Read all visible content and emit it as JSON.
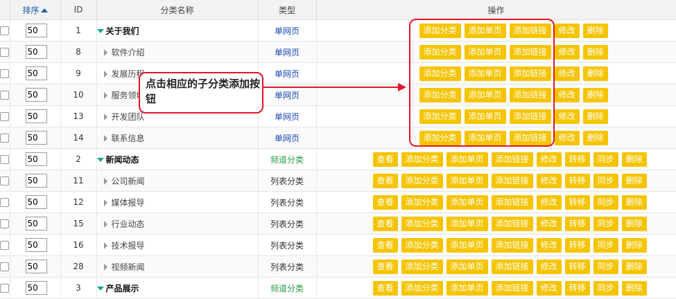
{
  "headers": {
    "sort": "排序",
    "id": "ID",
    "name": "分类名称",
    "type": "类型",
    "ops": "操作"
  },
  "rows": [
    {
      "sort": "50",
      "id": "1",
      "name": "关于我们",
      "level": 0,
      "type": "单网页",
      "type_class": "t-page",
      "ops": [
        "添加分类",
        "添加单页",
        "添加链接",
        "修改",
        "删除"
      ]
    },
    {
      "sort": "50",
      "id": "8",
      "name": "软件介绍",
      "level": 1,
      "type": "单网页",
      "type_class": "t-page",
      "ops": [
        "添加分类",
        "添加单页",
        "添加链接",
        "修改",
        "删除"
      ]
    },
    {
      "sort": "50",
      "id": "9",
      "name": "发展历程",
      "level": 1,
      "type": "单网页",
      "type_class": "t-page",
      "ops": [
        "添加分类",
        "添加单页",
        "添加链接",
        "修改",
        "删除"
      ]
    },
    {
      "sort": "50",
      "id": "10",
      "name": "服务领域",
      "level": 1,
      "type": "单网页",
      "type_class": "t-page",
      "ops": [
        "添加分类",
        "添加单页",
        "添加链接",
        "修改",
        "删除"
      ]
    },
    {
      "sort": "50",
      "id": "13",
      "name": "开发团队",
      "level": 1,
      "type": "单网页",
      "type_class": "t-page",
      "ops": [
        "添加分类",
        "添加单页",
        "添加链接",
        "修改",
        "删除"
      ]
    },
    {
      "sort": "50",
      "id": "14",
      "name": "联系信息",
      "level": 1,
      "type": "单网页",
      "type_class": "t-page",
      "ops": [
        "添加分类",
        "添加单页",
        "添加链接",
        "修改",
        "删除"
      ]
    },
    {
      "sort": "50",
      "id": "2",
      "name": "新闻动态",
      "level": 0,
      "type": "频道分类",
      "type_class": "t-channel",
      "ops": [
        "查看",
        "添加分类",
        "添加单页",
        "添加链接",
        "修改",
        "转移",
        "同步",
        "删除"
      ]
    },
    {
      "sort": "50",
      "id": "11",
      "name": "公司新闻",
      "level": 1,
      "type": "列表分类",
      "type_class": "t-list",
      "ops": [
        "查看",
        "添加分类",
        "添加单页",
        "添加链接",
        "修改",
        "转移",
        "同步",
        "删除"
      ]
    },
    {
      "sort": "50",
      "id": "12",
      "name": "媒体报导",
      "level": 1,
      "type": "列表分类",
      "type_class": "t-list",
      "ops": [
        "查看",
        "添加分类",
        "添加单页",
        "添加链接",
        "修改",
        "转移",
        "同步",
        "删除"
      ]
    },
    {
      "sort": "50",
      "id": "15",
      "name": "行业动态",
      "level": 1,
      "type": "列表分类",
      "type_class": "t-list",
      "ops": [
        "查看",
        "添加分类",
        "添加单页",
        "添加链接",
        "修改",
        "转移",
        "同步",
        "删除"
      ]
    },
    {
      "sort": "50",
      "id": "16",
      "name": "技术报导",
      "level": 1,
      "type": "列表分类",
      "type_class": "t-list",
      "ops": [
        "查看",
        "添加分类",
        "添加单页",
        "添加链接",
        "修改",
        "转移",
        "同步",
        "删除"
      ]
    },
    {
      "sort": "50",
      "id": "28",
      "name": "视频新闻",
      "level": 1,
      "type": "列表分类",
      "type_class": "t-list",
      "ops": [
        "查看",
        "添加分类",
        "添加单页",
        "添加链接",
        "修改",
        "转移",
        "同步",
        "删除"
      ]
    },
    {
      "sort": "50",
      "id": "3",
      "name": "产品展示",
      "level": 0,
      "type": "频道分类",
      "type_class": "t-channel",
      "ops": [
        "查看",
        "添加分类",
        "添加单页",
        "添加链接",
        "修改",
        "转移",
        "同步",
        "删除"
      ]
    }
  ],
  "annotation": {
    "text": "点击相应的子分类添加按钮"
  },
  "colors": {
    "button": "#f5c400",
    "highlight": "#e0142b",
    "channel": "#2f9a4a",
    "page": "#1a49b8"
  },
  "icons": {
    "expanded": "triangle-down-icon",
    "collapsed": "triangle-right-icon",
    "sort": "sort-up-icon"
  }
}
